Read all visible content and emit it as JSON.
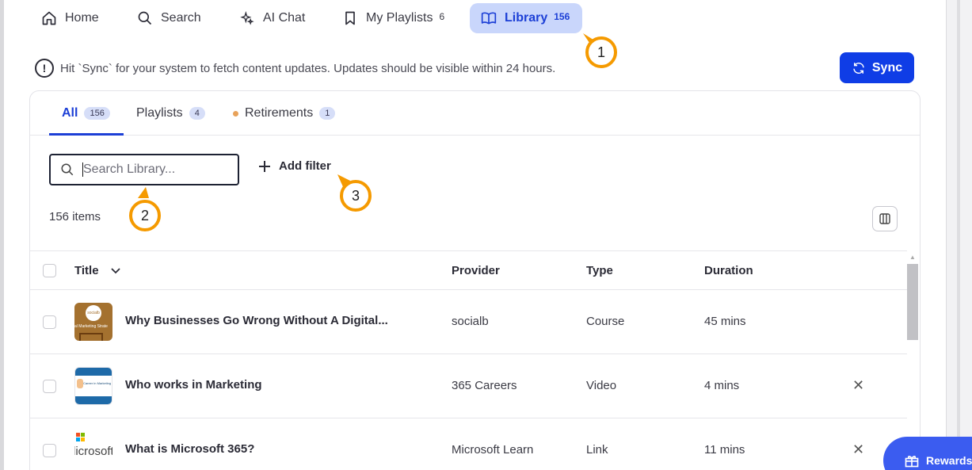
{
  "nav": {
    "items": [
      {
        "label": "Home",
        "icon": "home-icon"
      },
      {
        "label": "Search",
        "icon": "search-icon"
      },
      {
        "label": "AI Chat",
        "icon": "sparkle-icon"
      },
      {
        "label": "My Playlists",
        "icon": "bookmark-icon",
        "count": "6"
      },
      {
        "label": "Library",
        "icon": "book-icon",
        "count": "156"
      }
    ]
  },
  "callouts": [
    "1",
    "2",
    "3"
  ],
  "info": {
    "text": "Hit `Sync` for your system to fetch content updates. Updates should be visible within 24 hours."
  },
  "sync": {
    "label": "Sync"
  },
  "tabs": [
    {
      "label": "All",
      "count": "156"
    },
    {
      "label": "Playlists",
      "count": "4"
    },
    {
      "label": "Retirements",
      "count": "1"
    }
  ],
  "search": {
    "placeholder": "Search Library..."
  },
  "filter": {
    "label": "Add filter"
  },
  "items_count": "156 items",
  "table": {
    "headers": {
      "title": "Title",
      "provider": "Provider",
      "type": "Type",
      "duration": "Duration"
    },
    "rows": [
      {
        "title": "Why Businesses Go Wrong Without A Digital...",
        "provider": "socialb",
        "type": "Course",
        "duration": "45 mins",
        "thumb_text": "socialb",
        "thumb_sub": "al Marketing Strate"
      },
      {
        "title": "Who works in Marketing",
        "provider": "365 Careers",
        "type": "Video",
        "duration": "4 mins",
        "thumb_text": "Career in Marketing"
      },
      {
        "title": "What is Microsoft 365?",
        "provider": "Microsoft Learn",
        "type": "Link",
        "duration": "11 mins",
        "thumb_text": "licrosoft"
      }
    ]
  },
  "rewards": {
    "label": "Rewards"
  },
  "colors": {
    "accent": "#1c3fd6",
    "sync": "#0f3de6",
    "callout": "#f59a00",
    "active_tab_bg": "#c9d6fb"
  }
}
